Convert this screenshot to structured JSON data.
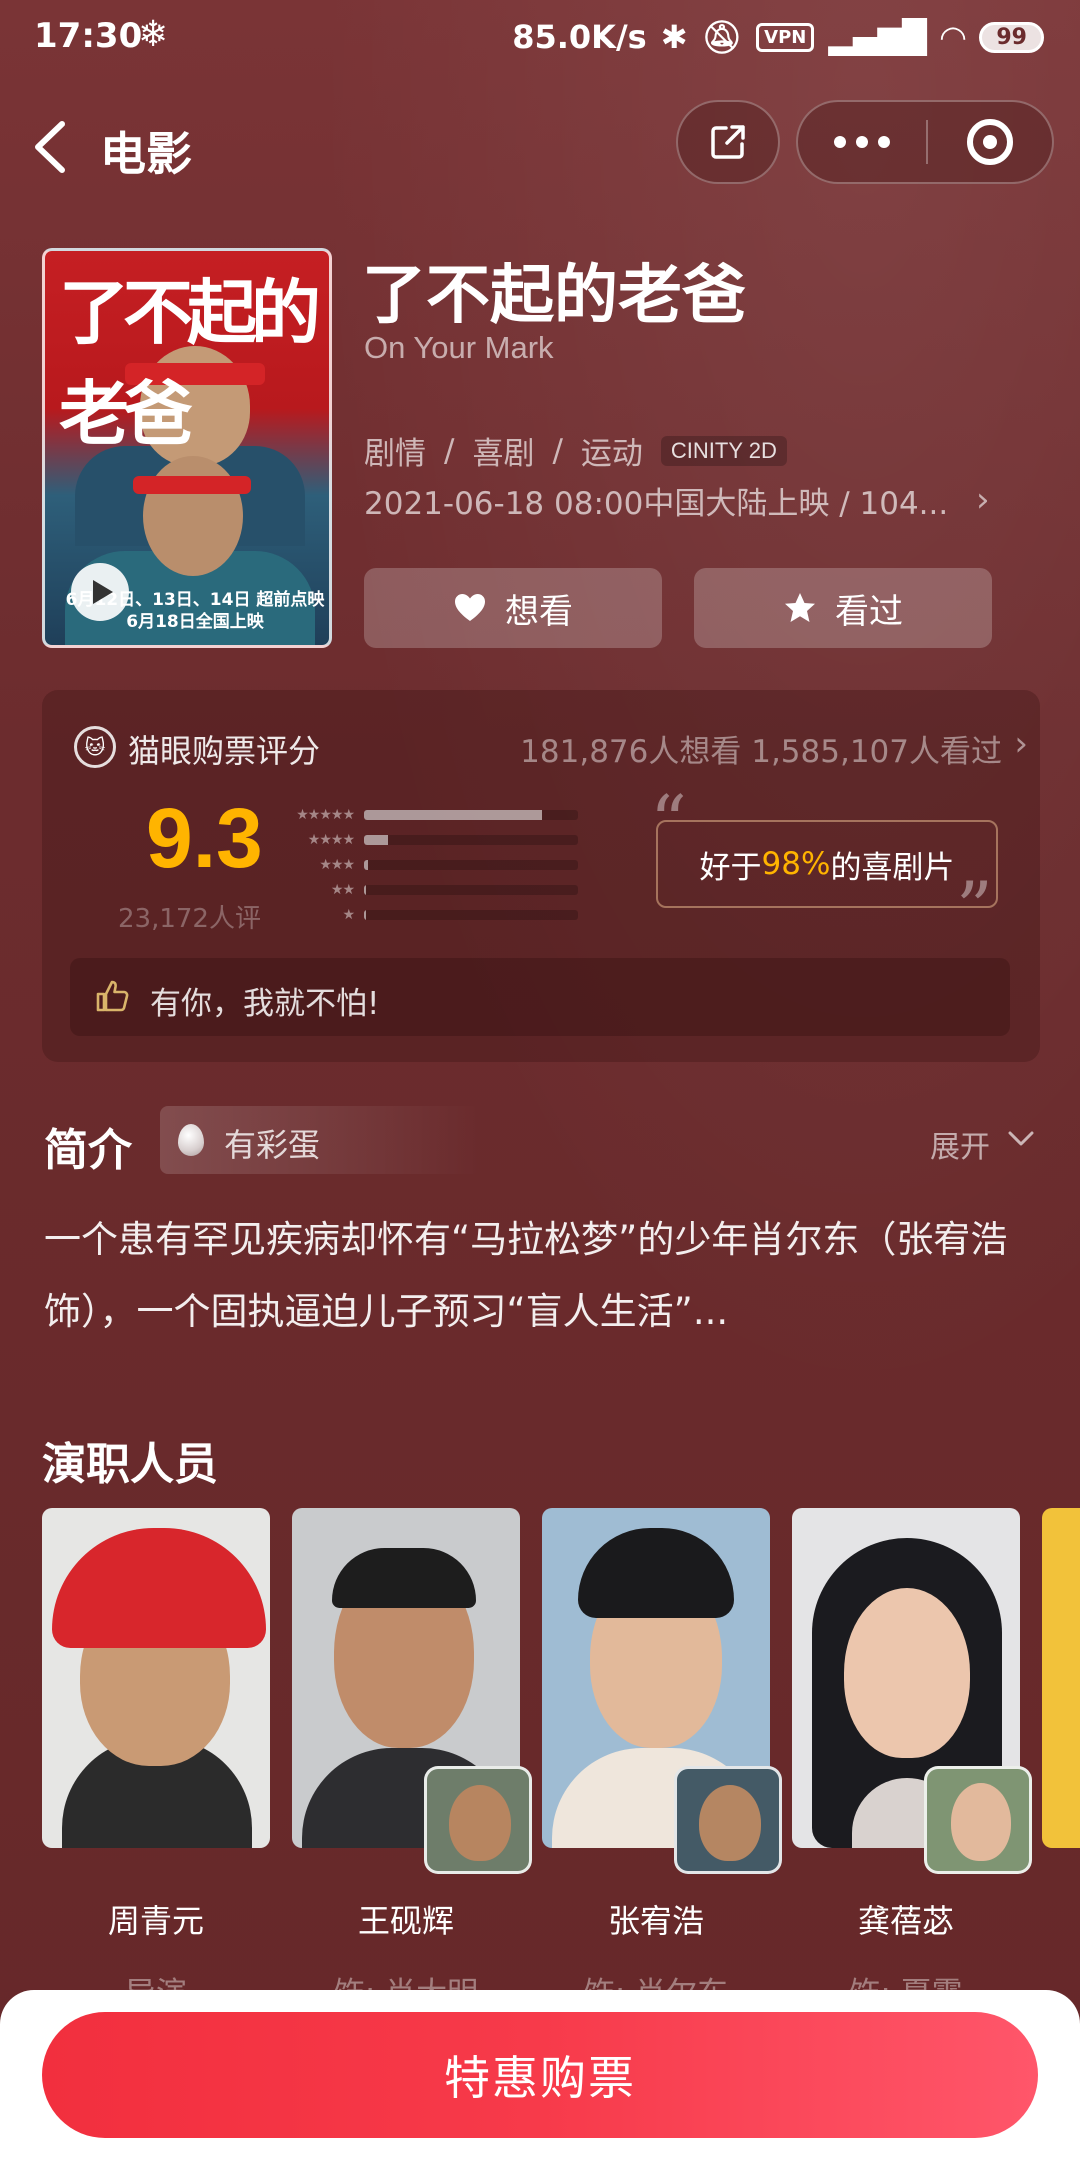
{
  "status_bar": {
    "time": "17:30",
    "network_speed": "85.0K/s",
    "vpn": "VPN",
    "battery": "99"
  },
  "nav": {
    "title": "电影"
  },
  "movie": {
    "poster_title": "了不起的老爸",
    "poster_date": "6月12日、13日、14日 超前点映\n6月18日全国上映",
    "title_cn": "了不起的老爸",
    "title_en": "On Your Mark",
    "genres": [
      "剧情",
      "喜剧",
      "运动"
    ],
    "genre_sep": "/",
    "format": "CINITY 2D",
    "release": "2021-06-18 08:00中国大陆上映 / 104...",
    "want_label": "想看",
    "seen_label": "看过"
  },
  "rating": {
    "source_label": "猫眼购票评分",
    "stats": "181,876人想看 1,585,107人看过",
    "score": "9.3",
    "count": "23,172人评",
    "distribution": [
      {
        "stars": "★★★★★",
        "fraction": 0.83
      },
      {
        "stars": "★★★★",
        "fraction": 0.11
      },
      {
        "stars": "★★★",
        "fraction": 0.02
      },
      {
        "stars": "★★",
        "fraction": 0.01
      },
      {
        "stars": "★",
        "fraction": 0.01
      }
    ],
    "quote_prefix": "好于",
    "quote_highlight": "98%",
    "quote_suffix": "的喜剧片",
    "review_text": "有你，我就不怕!"
  },
  "intro": {
    "title": "简介",
    "egg_label": "有彩蛋",
    "expand_label": "展开",
    "text": "一个患有罕见疾病却怀有“马拉松梦”的少年肖尔东（张宥浩 饰），一个固执逼迫儿子预习“盲人生活”..."
  },
  "cast": {
    "title": "演职人员",
    "members": [
      {
        "name": "周青元",
        "role": "导演"
      },
      {
        "name": "王砚辉",
        "role": "饰: 肖大明"
      },
      {
        "name": "张宥浩",
        "role": "饰: 肖尔东"
      },
      {
        "name": "龚蓓苾",
        "role": "饰: 夏露"
      }
    ]
  },
  "bottom": {
    "buy_label": "特惠购票"
  },
  "colors": {
    "background": "#6b2b2d",
    "score": "#ffb400",
    "buy_button": "#f22f3e"
  }
}
